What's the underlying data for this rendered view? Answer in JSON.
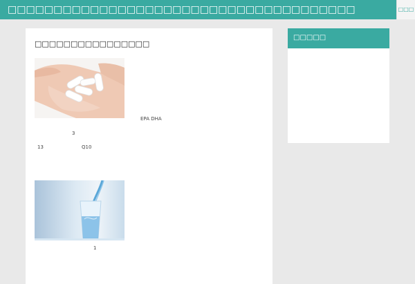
{
  "header": {
    "site_title": "□□□□□□□□□□□□□□□□□□□□□□□□□□□□□□□□□□□□□□",
    "menu_label": "□□□"
  },
  "article": {
    "title": "□□□□□□□□□□□□□□□□",
    "text_epa_dha": "EPA DHA",
    "text_3": "3",
    "text_13": "13",
    "text_q10": "Q10",
    "text_1": "1"
  },
  "sidebar": {
    "title": "□□□□□"
  },
  "colors": {
    "accent": "#3aaaa1",
    "background": "#e9e9e9"
  }
}
